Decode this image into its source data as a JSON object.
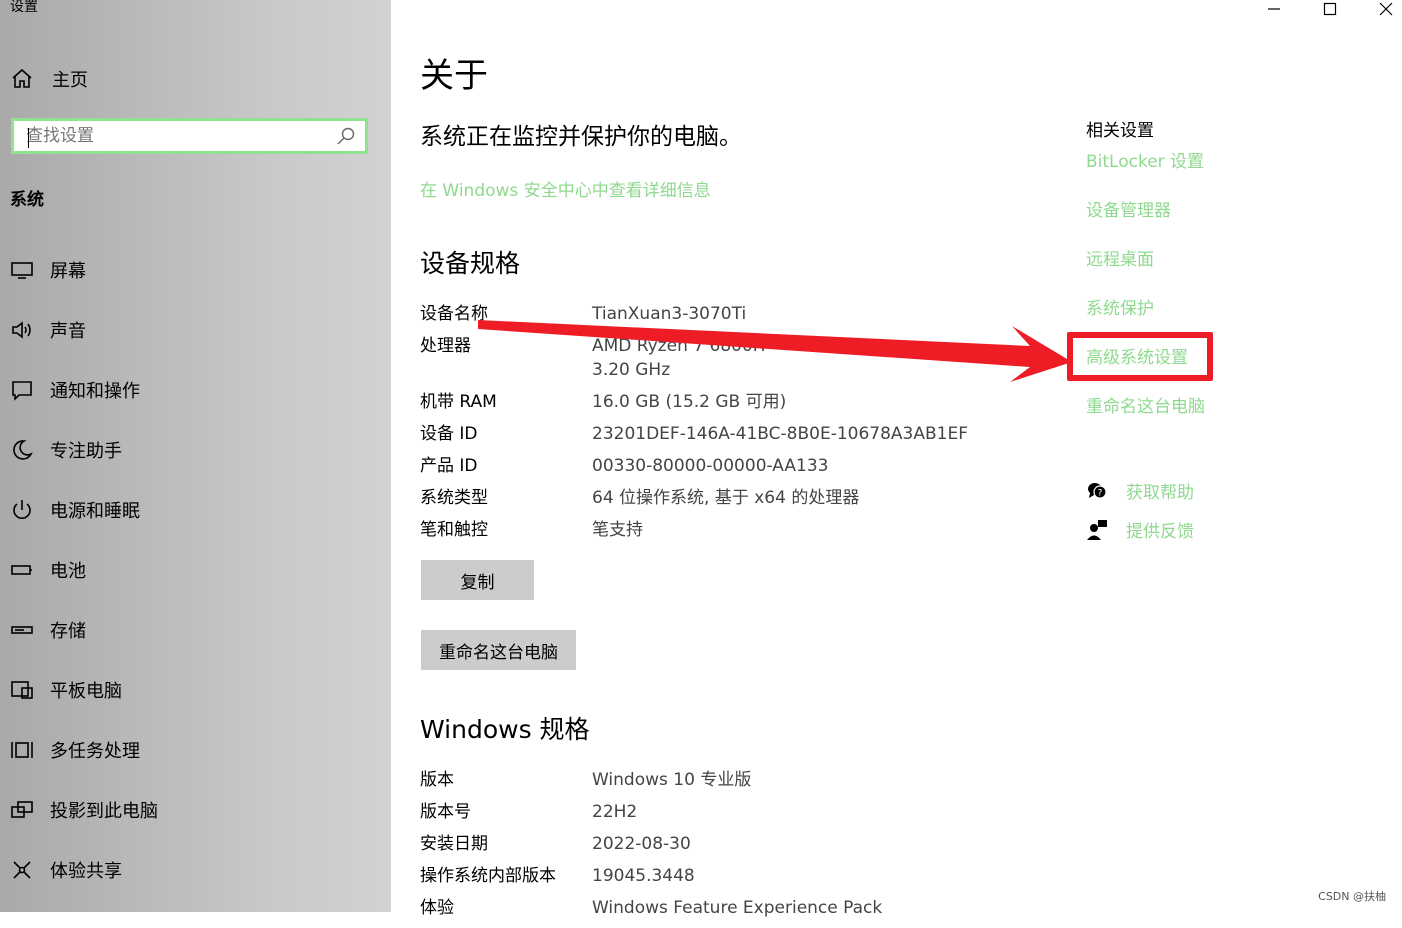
{
  "window": {
    "title": "设置",
    "controls": [
      {
        "name": "minimize",
        "glyph": "—"
      },
      {
        "name": "maximize",
        "glyph": "☐"
      },
      {
        "name": "close",
        "glyph": "✕"
      }
    ]
  },
  "sidebar": {
    "home_label": "主页",
    "search_placeholder": "查找设置",
    "section_title": "系统",
    "items": [
      {
        "label": "屏幕",
        "icon": "monitor-icon"
      },
      {
        "label": "声音",
        "icon": "speaker-icon"
      },
      {
        "label": "通知和操作",
        "icon": "notification-icon"
      },
      {
        "label": "专注助手",
        "icon": "moon-icon"
      },
      {
        "label": "电源和睡眠",
        "icon": "power-icon"
      },
      {
        "label": "电池",
        "icon": "battery-icon"
      },
      {
        "label": "存储",
        "icon": "storage-icon"
      },
      {
        "label": "平板电脑",
        "icon": "tablet-icon"
      },
      {
        "label": "多任务处理",
        "icon": "multitask-icon"
      },
      {
        "label": "投影到此电脑",
        "icon": "project-icon"
      },
      {
        "label": "体验共享",
        "icon": "share-icon"
      }
    ]
  },
  "main": {
    "title": "关于",
    "monitor_text": "系统正在监控并保护你的电脑。",
    "security_link": "在 Windows 安全中心中查看详细信息",
    "device_spec_title": "设备规格",
    "device_specs": [
      {
        "key": "设备名称",
        "value": "TianXuan3-3070Ti"
      },
      {
        "key": "处理器",
        "value": "AMD Ryzen 7 6800H",
        "value2": "3.20 GHz"
      },
      {
        "key": "机带 RAM",
        "value": "16.0 GB (15.2 GB 可用)"
      },
      {
        "key": "设备 ID",
        "value": "23201DEF-146A-41BC-8B0E-10678A3AB1EF"
      },
      {
        "key": "产品 ID",
        "value": "00330-80000-00000-AA133"
      },
      {
        "key": "系统类型",
        "value": "64 位操作系统, 基于 x64 的处理器"
      },
      {
        "key": "笔和触控",
        "value": "笔支持"
      }
    ],
    "copy_button": "复制",
    "rename_button": "重命名这台电脑",
    "windows_spec_title": "Windows 规格",
    "windows_specs": [
      {
        "key": "版本",
        "value": "Windows 10 专业版"
      },
      {
        "key": "版本号",
        "value": "22H2"
      },
      {
        "key": "安装日期",
        "value": "2022-08-30"
      },
      {
        "key": "操作系统内部版本",
        "value": "19045.3448"
      },
      {
        "key": "体验",
        "value": "Windows Feature Experience Pack"
      }
    ]
  },
  "related": {
    "title": "相关设置",
    "links": [
      "BitLocker 设置",
      "设备管理器",
      "远程桌面",
      "系统保护",
      "高级系统设置",
      "重命名这台电脑"
    ],
    "help_label": "获取帮助",
    "feedback_label": "提供反馈"
  },
  "colors": {
    "link": "#8fd98f",
    "search_border": "#8fe38f",
    "annotation": "#ee1c24",
    "button_bg": "#cccccc"
  },
  "watermark": "CSDN @扶柚"
}
